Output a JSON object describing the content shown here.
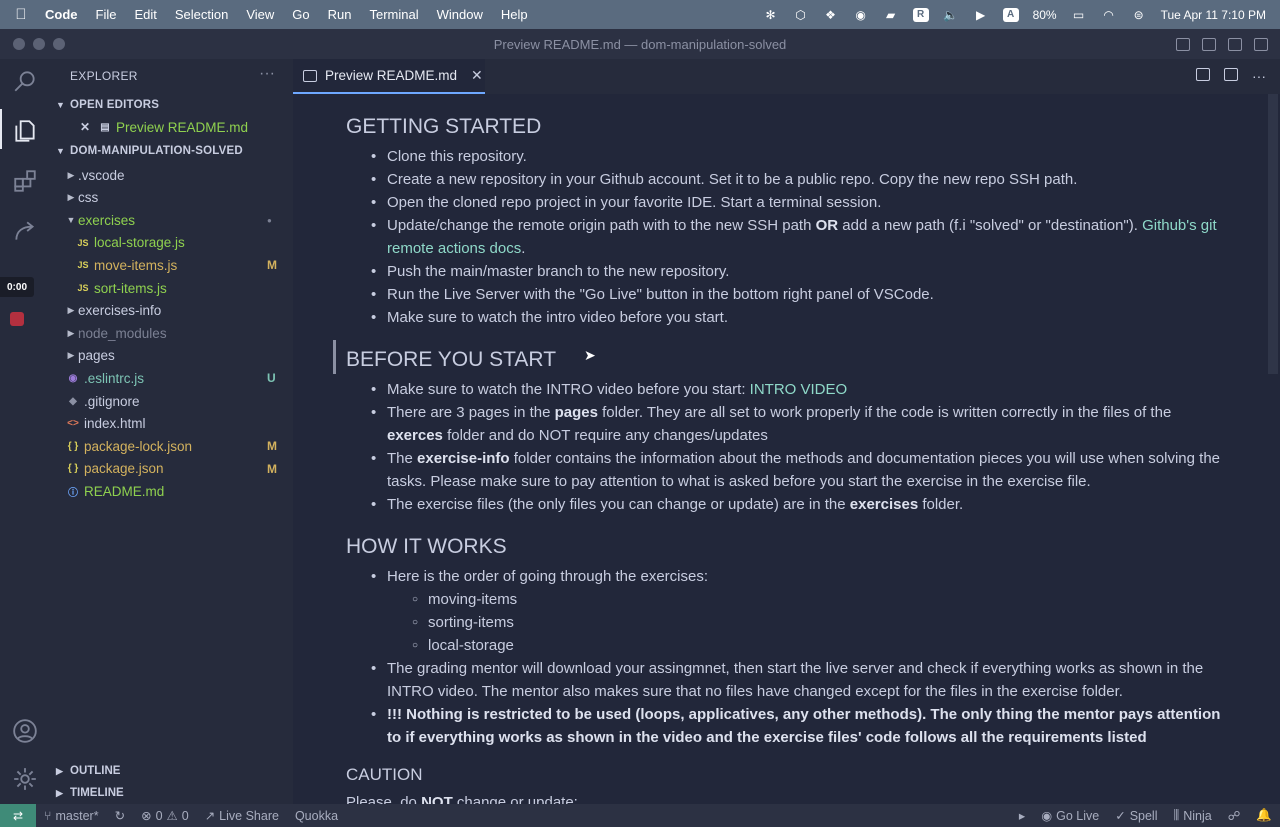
{
  "menubar": {
    "app": "Code",
    "menus": [
      "File",
      "Edit",
      "Selection",
      "View",
      "Go",
      "Run",
      "Terminal",
      "Window",
      "Help"
    ],
    "battery": "80%",
    "clock": "Tue Apr 11  7:10 PM"
  },
  "window": {
    "title": "Preview README.md — dom-manipulation-solved"
  },
  "recording": {
    "timer": "0:00"
  },
  "sidebar": {
    "title": "EXPLORER",
    "more": "···",
    "open_editors_label": "OPEN EDITORS",
    "open_editor_item": "Preview README.md",
    "project_label": "DOM-MANIPULATION-SOLVED",
    "tree": [
      {
        "label": ".vscode",
        "type": "folder",
        "open": false,
        "depth": 1,
        "badge": ""
      },
      {
        "label": "css",
        "type": "folder",
        "open": false,
        "depth": 1,
        "badge": ""
      },
      {
        "label": "exercises",
        "type": "folder",
        "open": true,
        "depth": 1,
        "badge": "●"
      },
      {
        "label": "local-storage.js",
        "type": "js",
        "depth": 2,
        "badge": ""
      },
      {
        "label": "move-items.js",
        "type": "js",
        "depth": 2,
        "badge": "M"
      },
      {
        "label": "sort-items.js",
        "type": "js",
        "depth": 2,
        "badge": ""
      },
      {
        "label": "exercises-info",
        "type": "folder",
        "open": false,
        "depth": 1,
        "badge": ""
      },
      {
        "label": "node_modules",
        "type": "folder",
        "open": false,
        "depth": 1,
        "badge": ""
      },
      {
        "label": "pages",
        "type": "folder",
        "open": false,
        "depth": 1,
        "badge": ""
      },
      {
        "label": ".eslintrc.js",
        "type": "eslint",
        "depth": 1,
        "badge": "U"
      },
      {
        "label": ".gitignore",
        "type": "git",
        "depth": 1,
        "badge": ""
      },
      {
        "label": "index.html",
        "type": "html",
        "depth": 1,
        "badge": ""
      },
      {
        "label": "package-lock.json",
        "type": "json",
        "depth": 1,
        "badge": "M"
      },
      {
        "label": "package.json",
        "type": "json",
        "depth": 1,
        "badge": "M"
      },
      {
        "label": "README.md",
        "type": "info",
        "depth": 1,
        "badge": ""
      }
    ],
    "outline_label": "OUTLINE",
    "timeline_label": "TIMELINE"
  },
  "tab": {
    "label": "Preview README.md",
    "close": "✕"
  },
  "doc": {
    "h_getting_started": "GETTING STARTED",
    "gs_1": "Clone this repository.",
    "gs_2": "Create a new repository in your Github account. Set it to be a public repo. Copy the new repo SSH path.",
    "gs_3": "Open the cloned repo project in your favorite IDE. Start a terminal session.",
    "gs_4a": "Update/change the remote origin path with to the new SSH path ",
    "gs_4_or": "OR",
    "gs_4b": " add a new path (f.i \"solved\" or \"destination\"). ",
    "gs_4_link": "Github's git remote actions docs",
    "gs_4c": ".",
    "gs_5": "Push the main/master branch to the new repository.",
    "gs_6": "Run the Live Server with the \"Go Live\" button in the bottom right panel of VSCode.",
    "gs_7": "Make sure to watch the intro video before you start.",
    "h_before": "BEFORE YOU START",
    "b_1a": "Make sure to watch the INTRO video before you start: ",
    "b_1_link": "INTRO VIDEO",
    "b_2a": "There are 3 pages in the ",
    "b_2_pages": "pages",
    "b_2b": " folder. They are all set to work properly if the code is written correctly in the files of the ",
    "b_2_exerces": "exerces",
    "b_2c": " folder and do NOT require any changes/updates",
    "b_3a": "The ",
    "b_3_info": "exercise-info",
    "b_3b": " folder contains the information about the methods and documentation pieces you will use when solving the tasks. Please make sure to pay attention to what is asked before you start the exercise in the exercise file.",
    "b_4a": "The exercise files (the only files you can change or update) are in the ",
    "b_4_exercises": "exercises",
    "b_4b": " folder.",
    "h_how": "HOW IT WORKS",
    "h_1": "Here is the order of going through the exercises:",
    "h_sub_1": "moving-items",
    "h_sub_2": "sorting-items",
    "h_sub_3": "local-storage",
    "h_2": "The grading mentor will download your assingmnet, then start the live server and check if everything works as shown in the INTRO video. The mentor also makes sure that no files have changed except for the files in the exercise folder.",
    "h_3": "!!! Nothing is restricted to be used (loops, applicatives, any other methods). The only thing the mentor pays attention to if everything works as shown in the video and the exercise files' code follows all the requirements listed",
    "h_caution": "CAUTION",
    "c_1a": "Please, do ",
    "c_1_not": "NOT",
    "c_1b": " change or update:"
  },
  "statusbar": {
    "branch": "master*",
    "errors": "0",
    "warnings": "0",
    "live_share": "Live Share",
    "quokka": "Quokka",
    "go_live": "Go Live",
    "spell": "Spell",
    "ninja": "Ninja"
  },
  "colors": {
    "accent": "#6ea8ff",
    "link": "#8fd9c9",
    "modified": "#d3b25e",
    "untracked": "#7dc4b4",
    "js_file": "#8fd14f",
    "remote": "#3f8b78"
  }
}
